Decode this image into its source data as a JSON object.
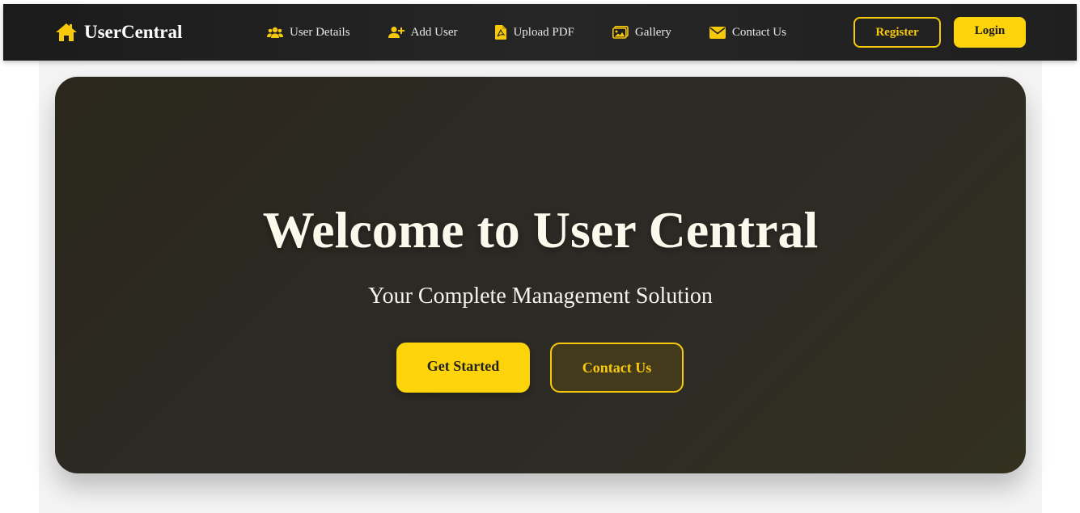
{
  "colors": {
    "accent": "#fdd40a",
    "navbar_bg": "#1f1f1f",
    "hero_bg": "#2c2a24",
    "page_bg": "#f4f4f5"
  },
  "navbar": {
    "brand": {
      "label": "UserCentral",
      "icon": "home-icon"
    },
    "links": [
      {
        "label": "User Details",
        "icon": "users-icon"
      },
      {
        "label": "Add User",
        "icon": "user-plus-icon"
      },
      {
        "label": "Upload PDF",
        "icon": "pdf-file-icon"
      },
      {
        "label": "Gallery",
        "icon": "images-icon"
      },
      {
        "label": "Contact Us",
        "icon": "envelope-icon"
      }
    ],
    "register_label": "Register",
    "login_label": "Login"
  },
  "hero": {
    "title": "Welcome to User Central",
    "subtitle": "Your Complete Management Solution",
    "primary_button": "Get Started",
    "secondary_button": "Contact Us"
  }
}
